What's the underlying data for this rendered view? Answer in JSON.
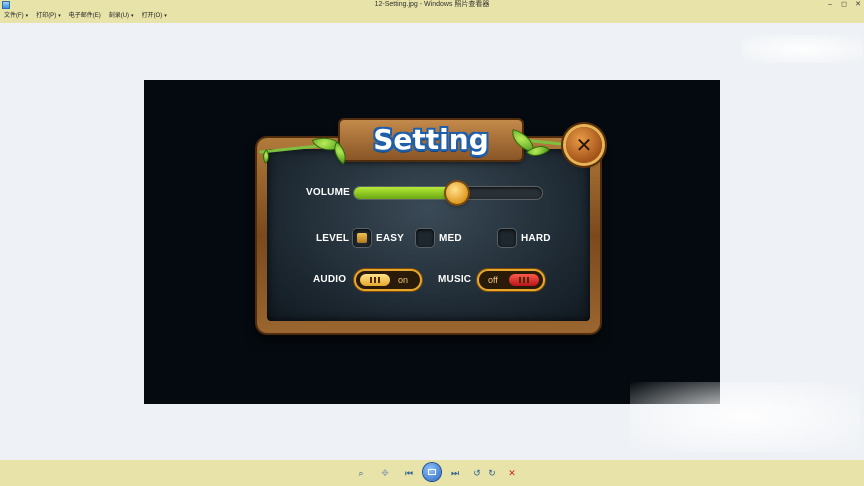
{
  "window": {
    "title": "12-Setting.jpg - Windows 照片查看器",
    "minimize": "–",
    "maximize": "◻",
    "close": "✕"
  },
  "menu": [
    {
      "label": "文件(F)"
    },
    {
      "label": "打印(P)"
    },
    {
      "label": "电子邮件(E)"
    },
    {
      "label": "刻录(U)"
    },
    {
      "label": "打开(O)"
    }
  ],
  "game": {
    "title": "Setting",
    "close_glyph": "✕",
    "volume": {
      "label": "VOLUME",
      "value": 0.55
    },
    "level": {
      "label": "LEVEL",
      "options": [
        {
          "label": "EASY",
          "checked": true
        },
        {
          "label": "MED",
          "checked": false
        },
        {
          "label": "HARD",
          "checked": false
        }
      ]
    },
    "audio": {
      "label": "AUDIO",
      "state": "on"
    },
    "music": {
      "label": "MUSIC",
      "state": "off"
    }
  },
  "toolbar": {
    "zoom": "⌕",
    "fit": "✥",
    "prev": "⏮",
    "next": "⏭",
    "rotate_ccw": "↺",
    "rotate_cw": "↻",
    "delete": "✕"
  },
  "colors": {
    "chrome": "#e7e3a9",
    "slider_fill": "#8cc424",
    "toggle_on": "#f2c24a",
    "toggle_off": "#d8262a"
  }
}
